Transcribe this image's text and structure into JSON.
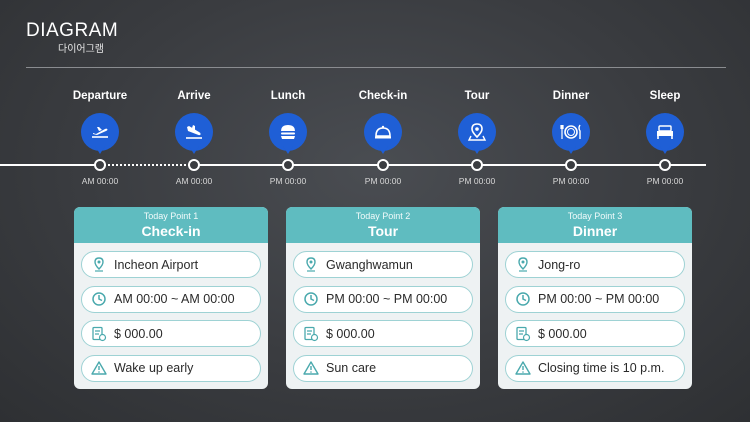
{
  "header": {
    "title": "DIAGRAM",
    "subtitle": "다이어그램"
  },
  "steps": [
    {
      "label": "Departure",
      "icon": "airplane-takeoff-icon",
      "time": "AM 00:00"
    },
    {
      "label": "Arrive",
      "icon": "airplane-landing-icon",
      "time": "AM 00:00"
    },
    {
      "label": "Lunch",
      "icon": "burger-icon",
      "time": "PM 00:00"
    },
    {
      "label": "Check-in",
      "icon": "bell-icon",
      "time": "PM 00:00"
    },
    {
      "label": "Tour",
      "icon": "map-pin-icon",
      "time": "PM 00:00"
    },
    {
      "label": "Dinner",
      "icon": "plate-cutlery-icon",
      "time": "PM 00:00"
    },
    {
      "label": "Sleep",
      "icon": "bed-icon",
      "time": "PM 00:00"
    }
  ],
  "cards": [
    {
      "point": "Today Point 1",
      "title": "Check-in",
      "location": "Incheon Airport",
      "time": "AM 00:00 ~ AM 00:00",
      "cost": "$ 000.00",
      "note": "Wake up early"
    },
    {
      "point": "Today Point 2",
      "title": "Tour",
      "location": "Gwanghwamun",
      "time": "PM 00:00 ~ PM 00:00",
      "cost": "$ 000.00",
      "note": "Sun care"
    },
    {
      "point": "Today Point 3",
      "title": "Dinner",
      "location": "Jong-ro",
      "time": "PM 00:00 ~ PM 00:00",
      "cost": "$ 000.00",
      "note": "Closing time is 10 p.m."
    }
  ],
  "colors": {
    "accent_blue": "#1f5fd6",
    "teal": "#5fbcc0",
    "background": "#3a3c40"
  }
}
